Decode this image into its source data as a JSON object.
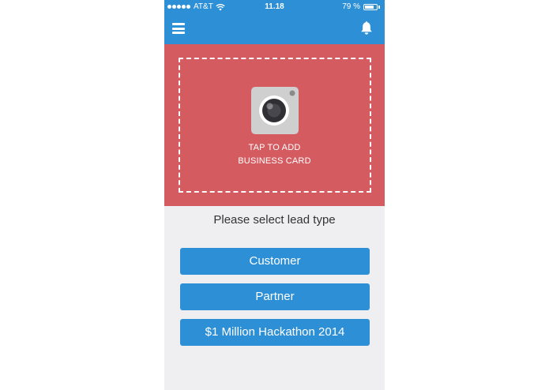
{
  "status_bar": {
    "carrier": "AT&T",
    "time": "11.18",
    "battery_text": "79 %",
    "battery_level": 0.79,
    "icons": [
      "signal-dots",
      "wifi-icon",
      "battery-icon"
    ]
  },
  "nav_bar": {
    "icons": [
      "menu-icon",
      "bell-icon"
    ]
  },
  "card": {
    "line1": "TAP TO ADD",
    "line2": "BUSINESS CARD",
    "icon": "camera-icon"
  },
  "lead": {
    "prompt": "Please select lead type",
    "options": [
      {
        "label": "Customer"
      },
      {
        "label": "Partner"
      },
      {
        "label": "$1 Million Hackathon 2014"
      }
    ]
  },
  "colors": {
    "primary_blue": "#2d8fd5",
    "card_red": "#d45c61",
    "background": "#efeff1",
    "text_dark": "#333333"
  }
}
